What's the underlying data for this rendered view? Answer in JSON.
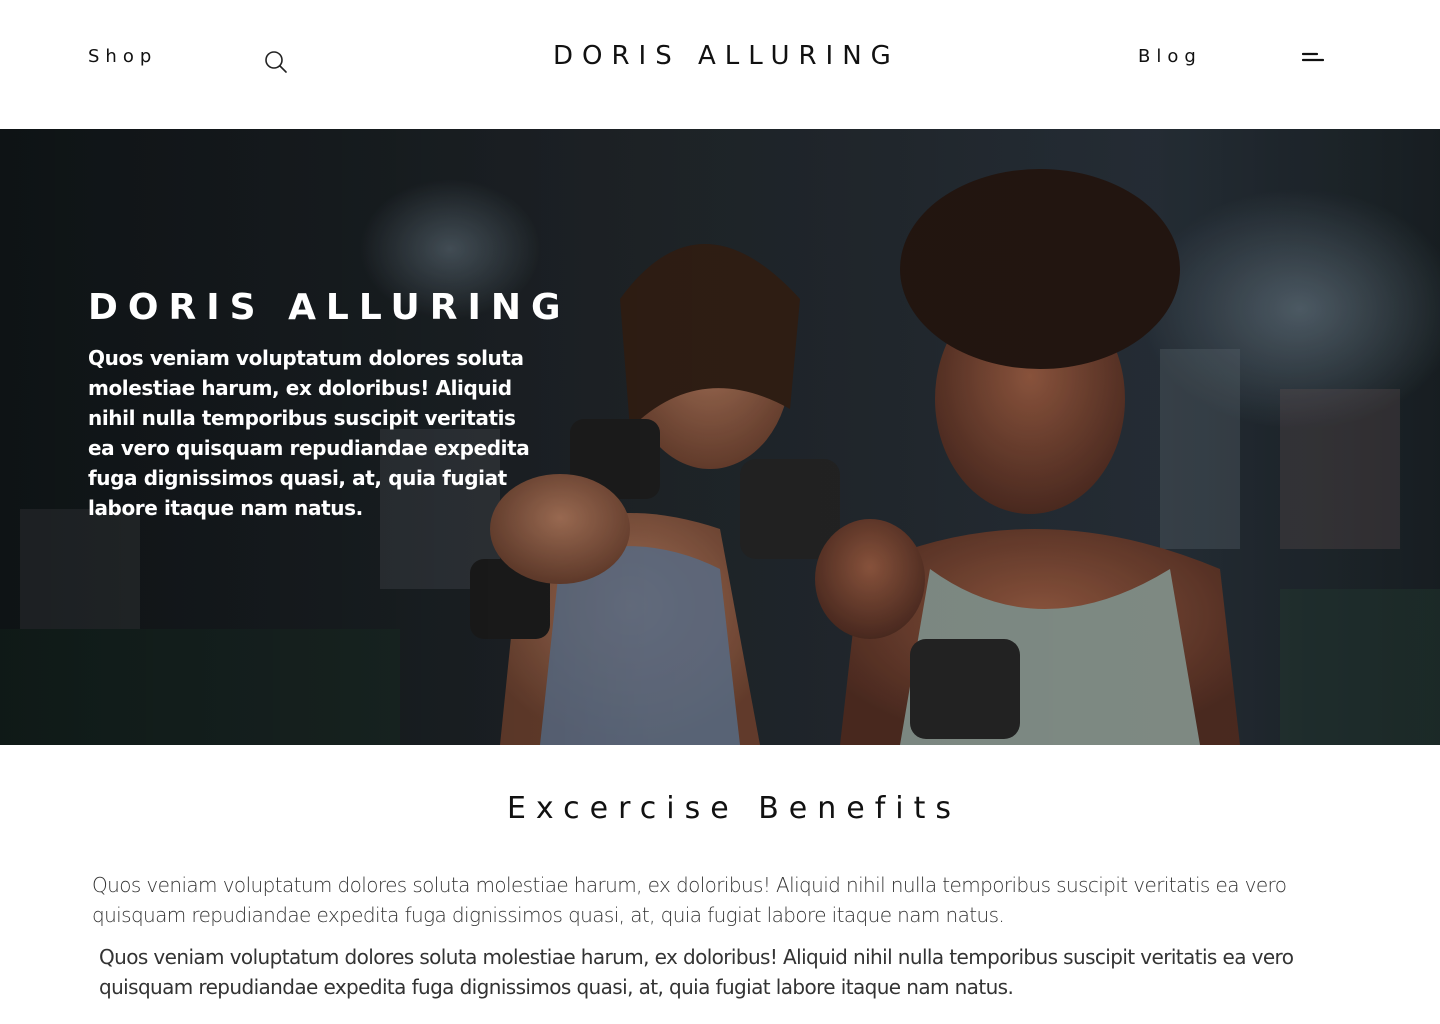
{
  "header": {
    "shop_label": "Shop",
    "brand": "DORIS ALLURING",
    "blog_label": "Blog",
    "search_icon": "search-icon",
    "menu_icon": "menu-icon"
  },
  "hero": {
    "title": "DORIS ALLURING",
    "text": "Quos veniam voluptatum dolores soluta molestiae harum, ex doloribus! Aliquid nihil nulla temporibus suscipit veritatis ea vero quisquam repudiandae expedita fuga dignissimos quasi, at, quia fugiat labore itaque nam natus.",
    "image_alt": "Two women smiling while lifting dumbbells in a gym"
  },
  "benefits": {
    "title": "Excercise Benefits",
    "paragraph_1": "Quos veniam voluptatum dolores soluta molestiae harum, ex doloribus! Aliquid nihil nulla temporibus suscipit veritatis ea vero quisquam repudiandae expedita fuga dignissimos quasi, at, quia fugiat labore itaque nam natus.",
    "paragraph_2": "Quos veniam voluptatum dolores soluta molestiae harum, ex doloribus! Aliquid nihil nulla temporibus suscipit veritatis ea vero quisquam repudiandae expedita fuga dignissimos quasi, at, quia fugiat labore itaque nam natus."
  },
  "colors": {
    "text": "#111111",
    "hero_overlay": "#1e252a",
    "background": "#ffffff"
  }
}
